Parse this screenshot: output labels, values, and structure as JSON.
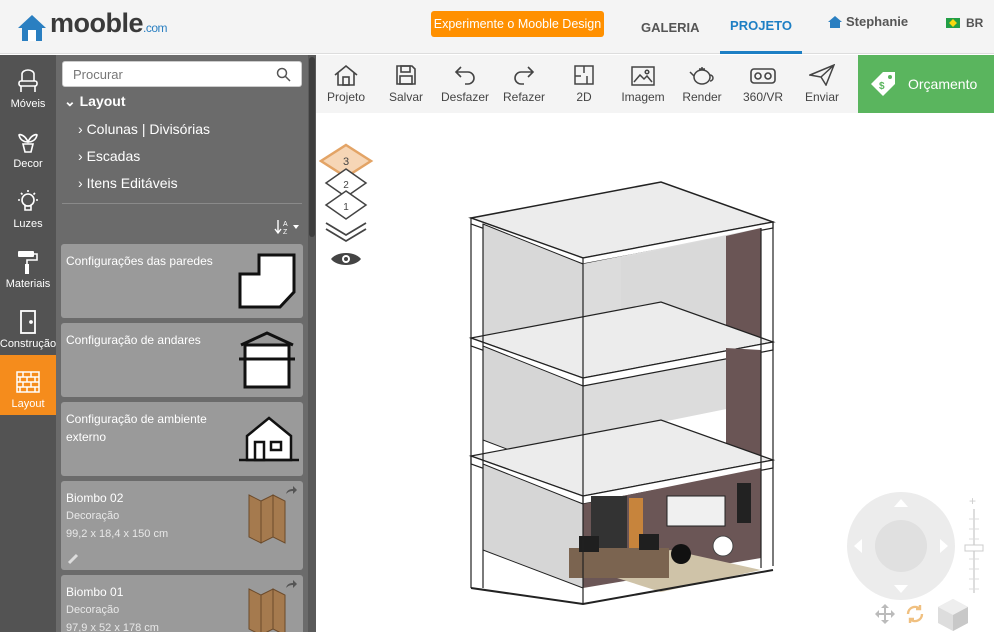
{
  "header": {
    "logo_text": "mooble",
    "logo_suffix": ".com",
    "try_button": "Experimente o Mooble Design",
    "nav": [
      {
        "label": "GALERIA"
      },
      {
        "label": "PROJETO"
      }
    ],
    "user": "Stephanie",
    "lang": "BR"
  },
  "sidebar": {
    "tools": [
      {
        "label": "Móveis",
        "icon": "chair-icon"
      },
      {
        "label": "Decor",
        "icon": "plant-icon"
      },
      {
        "label": "Luzes",
        "icon": "bulb-icon"
      },
      {
        "label": "Materiais",
        "icon": "paint-roller-icon"
      },
      {
        "label": "Construção",
        "icon": "door-icon"
      },
      {
        "label": "Layout",
        "icon": "brick-wall-icon"
      }
    ]
  },
  "panel": {
    "search_placeholder": "Procurar",
    "tree_root": "Layout",
    "tree_items": [
      "Colunas | Divisórias",
      "Escadas",
      "Itens Editáveis"
    ],
    "cards": [
      {
        "title": "Configurações das paredes"
      },
      {
        "title": "Configuração de andares"
      },
      {
        "title": "Configuração de ambiente externo"
      },
      {
        "title": "Biombo 02",
        "category": "Decoração",
        "size": "99,2 x 18,4 x 150 cm"
      },
      {
        "title": "Biombo 01",
        "category": "Decoração",
        "size": "97,9 x 52 x 178 cm"
      }
    ]
  },
  "toolbar": {
    "items": [
      {
        "label": "Projeto",
        "icon": "house-icon"
      },
      {
        "label": "Salvar",
        "icon": "floppy-icon"
      },
      {
        "label": "Desfazer",
        "icon": "undo-icon"
      },
      {
        "label": "Refazer",
        "icon": "redo-icon"
      },
      {
        "label": "2D",
        "icon": "floorplan-icon"
      },
      {
        "label": "Imagem",
        "icon": "image-icon"
      },
      {
        "label": "Render",
        "icon": "teapot-icon"
      },
      {
        "label": "360/VR",
        "icon": "vr-headset-icon"
      },
      {
        "label": "Enviar",
        "icon": "paper-plane-icon"
      }
    ],
    "quote_label": "Orçamento"
  },
  "canvas": {
    "floors": [
      "3",
      "2",
      "1"
    ],
    "active_floor": "3"
  },
  "colors": {
    "accent_orange": "#f58c1c",
    "brand_blue": "#1d7fc4",
    "quote_green": "#5ab55e",
    "sidebar_dark": "#535353",
    "panel_grey": "#6b6b6b"
  }
}
